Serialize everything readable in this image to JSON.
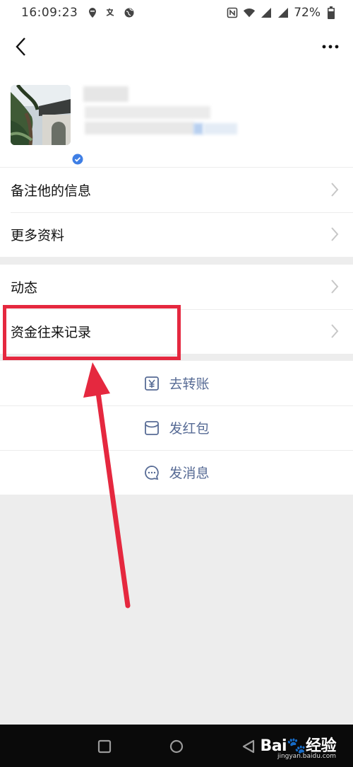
{
  "status_bar": {
    "time": "16:09:23",
    "battery": "72%"
  },
  "title_bar": {
    "back_icon": "chevron-left-icon",
    "more_icon": "ellipsis-icon"
  },
  "profile": {
    "verified_icon": "verified-check-icon"
  },
  "menu_group_1": [
    {
      "label": "备注他的信息"
    },
    {
      "label": "更多资料"
    }
  ],
  "menu_group_2": [
    {
      "label": "动态"
    },
    {
      "label": "资金往来记录"
    }
  ],
  "actions": [
    {
      "label": "去转账",
      "icon": "transfer-yuan-icon"
    },
    {
      "label": "发红包",
      "icon": "red-envelope-icon"
    },
    {
      "label": "发消息",
      "icon": "chat-bubble-icon"
    }
  ],
  "annotation": {
    "color": "#e5283f"
  },
  "colors": {
    "action_text": "#576b95",
    "page_bg": "#ededed"
  },
  "watermark": {
    "logo": "Bai🐾经验",
    "site": "jingyan.baidu.com"
  }
}
